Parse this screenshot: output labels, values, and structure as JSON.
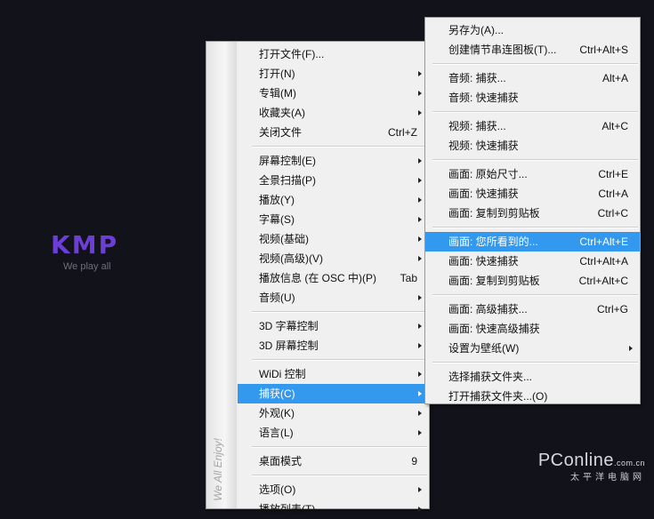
{
  "logo": {
    "letters": [
      "K",
      "M",
      "P"
    ],
    "tagline": "We play all"
  },
  "watermark": {
    "brand": "PConline",
    "domain": ".com.cn",
    "sub": "太平洋电脑网"
  },
  "sidebar_text": "We All Enjoy!",
  "main_menu": [
    {
      "label": "打开文件(F)...",
      "shortcut": "",
      "submenu": false
    },
    {
      "label": "打开(N)",
      "shortcut": "",
      "submenu": true
    },
    {
      "label": "专辑(M)",
      "shortcut": "",
      "submenu": true
    },
    {
      "label": "收藏夹(A)",
      "shortcut": "",
      "submenu": true
    },
    {
      "label": "关闭文件",
      "shortcut": "Ctrl+Z",
      "submenu": false
    },
    {
      "separator": true
    },
    {
      "label": "屏幕控制(E)",
      "shortcut": "",
      "submenu": true
    },
    {
      "label": "全景扫描(P)",
      "shortcut": "",
      "submenu": true
    },
    {
      "label": "播放(Y)",
      "shortcut": "",
      "submenu": true
    },
    {
      "label": "字幕(S)",
      "shortcut": "",
      "submenu": true
    },
    {
      "label": "视频(基础)",
      "shortcut": "",
      "submenu": true
    },
    {
      "label": "视频(高级)(V)",
      "shortcut": "",
      "submenu": true
    },
    {
      "label": "播放信息 (在 OSC 中)(P)",
      "shortcut": "Tab",
      "submenu": false
    },
    {
      "label": "音频(U)",
      "shortcut": "",
      "submenu": true
    },
    {
      "separator": true
    },
    {
      "label": "3D 字幕控制",
      "shortcut": "",
      "submenu": true
    },
    {
      "label": "3D 屏幕控制",
      "shortcut": "",
      "submenu": true
    },
    {
      "separator": true
    },
    {
      "label": "WiDi 控制",
      "shortcut": "",
      "submenu": true
    },
    {
      "label": "捕获(C)",
      "shortcut": "",
      "submenu": true,
      "highlight": true
    },
    {
      "label": "外观(K)",
      "shortcut": "",
      "submenu": true
    },
    {
      "label": "语言(L)",
      "shortcut": "",
      "submenu": true
    },
    {
      "separator": true
    },
    {
      "label": "桌面模式",
      "shortcut": "9",
      "submenu": false
    },
    {
      "separator": true
    },
    {
      "label": "选项(O)",
      "shortcut": "",
      "submenu": true
    },
    {
      "label": "播放列表(T)",
      "shortcut": "",
      "submenu": true
    }
  ],
  "capture_submenu": [
    {
      "label": "另存为(A)...",
      "shortcut": ""
    },
    {
      "label": "创建情节串连图板(T)...",
      "shortcut": "Ctrl+Alt+S"
    },
    {
      "separator": true
    },
    {
      "label": "音频: 捕获...",
      "shortcut": "Alt+A"
    },
    {
      "label": "音频: 快速捕获",
      "shortcut": ""
    },
    {
      "separator": true
    },
    {
      "label": "视频: 捕获...",
      "shortcut": "Alt+C"
    },
    {
      "label": "视频: 快速捕获",
      "shortcut": ""
    },
    {
      "separator": true
    },
    {
      "label": "画面: 原始尺寸...",
      "shortcut": "Ctrl+E"
    },
    {
      "label": "画面: 快速捕获",
      "shortcut": "Ctrl+A"
    },
    {
      "label": "画面: 复制到剪贴板",
      "shortcut": "Ctrl+C"
    },
    {
      "separator": true
    },
    {
      "label": "画面: 您所看到的...",
      "shortcut": "Ctrl+Alt+E",
      "highlight": true
    },
    {
      "label": "画面: 快速捕获",
      "shortcut": "Ctrl+Alt+A"
    },
    {
      "label": "画面: 复制到剪贴板",
      "shortcut": "Ctrl+Alt+C"
    },
    {
      "separator": true
    },
    {
      "label": "画面: 高级捕获...",
      "shortcut": "Ctrl+G"
    },
    {
      "label": "画面: 快速高级捕获",
      "shortcut": ""
    },
    {
      "label": "设置为壁纸(W)",
      "shortcut": "",
      "submenu": true
    },
    {
      "separator": true
    },
    {
      "label": "选择捕获文件夹...",
      "shortcut": ""
    },
    {
      "label": "打开捕获文件夹...(O)",
      "shortcut": ""
    }
  ],
  "colors": {
    "background": "#12131a",
    "menu_bg": "#f0f0f0",
    "highlight": "#3399ee",
    "logo": "#6b3fd6"
  }
}
